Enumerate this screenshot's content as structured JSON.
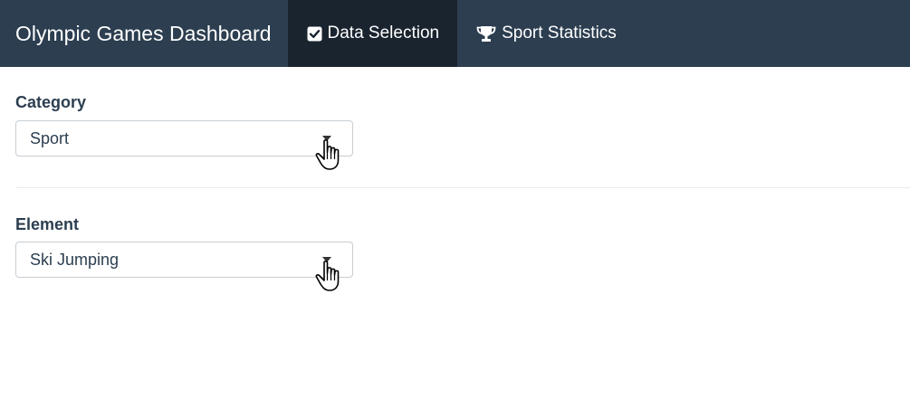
{
  "navbar": {
    "brand": "Olympic Games Dashboard",
    "tabs": [
      {
        "label": "Data Selection",
        "icon": "check-square-icon",
        "active": true
      },
      {
        "label": "Sport Statistics",
        "icon": "trophy-icon",
        "active": false
      }
    ],
    "bg_color": "#2c3e50",
    "active_tab_color": "#1a242f"
  },
  "form": {
    "category": {
      "label": "Category",
      "selected": "Sport"
    },
    "element": {
      "label": "Element",
      "selected": "Ski Jumping"
    }
  }
}
